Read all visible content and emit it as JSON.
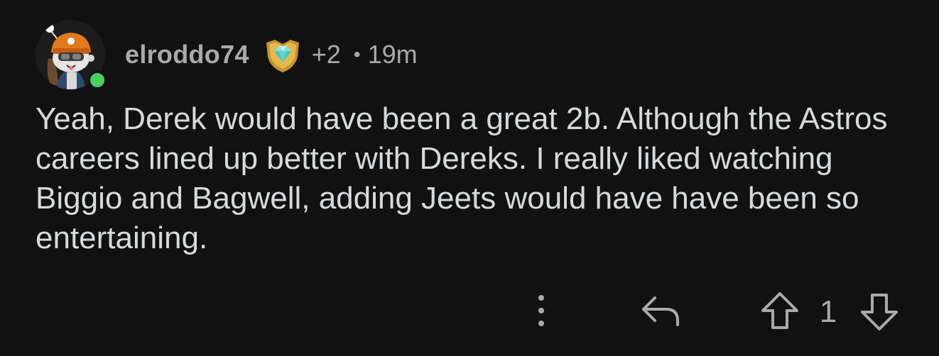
{
  "comment": {
    "author": "elroddo74",
    "award_icon": "diamond-shield-award-icon",
    "award_count": "+2",
    "separator": "•",
    "time_ago": "19m",
    "online_status_color": "#46d160",
    "body": "Yeah, Derek would have been a great 2b. Although the Astros careers lined up better with Dereks. I really liked watching Biggio and Bagwell, adding Jeets would have have been so entertaining.",
    "score": "1"
  },
  "actions": {
    "more_icon": "vertical-dots-icon",
    "reply_icon": "reply-arrow-icon",
    "upvote_icon": "upvote-arrow-icon",
    "downvote_icon": "downvote-arrow-icon"
  },
  "colors": {
    "background": "#111111",
    "text": "#d7dadc",
    "meta": "#a8aaab"
  }
}
